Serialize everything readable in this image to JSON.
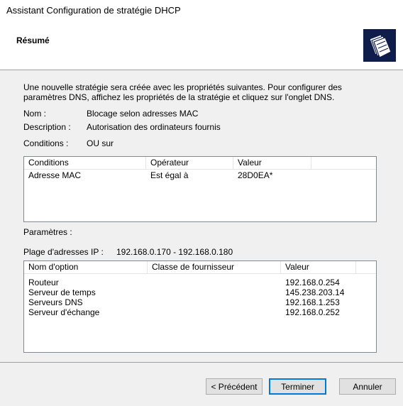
{
  "window": {
    "title": "Assistant Configuration de stratégie DHCP"
  },
  "header": {
    "title": "Résumé",
    "icon": "wizard-folder-icon"
  },
  "summary": {
    "intro_line1": "Une nouvelle stratégie sera créée avec les propriétés suivantes. Pour configurer des",
    "intro_line2": "paramètres DNS, affichez les propriétés de la stratégie et cliquez sur l'onglet DNS.",
    "name_label": "Nom :",
    "name_value": "Blocage selon adresses MAC",
    "desc_label": "Description :",
    "desc_value": "Autorisation des ordinateurs fournis",
    "conditions_label": "Conditions :",
    "conditions_value": "OU sur"
  },
  "conditions_table": {
    "columns": [
      "Conditions",
      "Opérateur",
      "Valeur"
    ],
    "rows": [
      [
        "Adresse MAC",
        "Est égal à",
        "28D0EA*"
      ]
    ]
  },
  "parameters": {
    "label": "Paramètres :",
    "ip_range_label": "Plage d'adresses IP :",
    "ip_range_value": "192.168.0.170 - 192.168.0.180"
  },
  "options_table": {
    "columns": [
      "Nom d'option",
      "Classe de fournisseur",
      "Valeur"
    ],
    "rows": [
      [
        "Routeur",
        "",
        "192.168.0.254"
      ],
      [
        "Serveur de temps",
        "",
        "145.238.203.14"
      ],
      [
        "Serveurs DNS",
        "",
        "192.168.1.253"
      ],
      [
        "Serveur d'échange",
        "",
        "192.168.0.252"
      ]
    ]
  },
  "buttons": {
    "back": "< Précédent",
    "finish": "Terminer",
    "cancel": "Annuler"
  },
  "colors": {
    "focus_border": "#0078d7",
    "header_bg": "#ffffff",
    "dialog_bg": "#f0f0f0"
  }
}
